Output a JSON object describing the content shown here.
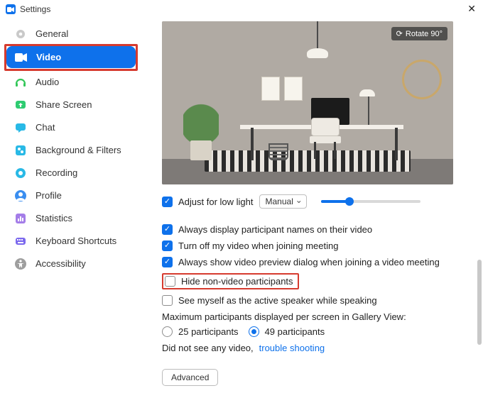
{
  "window": {
    "title": "Settings"
  },
  "sidebar": {
    "items": [
      {
        "id": "general",
        "label": "General",
        "icon": "gear-icon"
      },
      {
        "id": "video",
        "label": "Video",
        "icon": "video-icon",
        "active": true
      },
      {
        "id": "audio",
        "label": "Audio",
        "icon": "headphones-icon"
      },
      {
        "id": "share",
        "label": "Share Screen",
        "icon": "share-screen-icon"
      },
      {
        "id": "chat",
        "label": "Chat",
        "icon": "chat-icon"
      },
      {
        "id": "bgfilters",
        "label": "Background & Filters",
        "icon": "filters-icon"
      },
      {
        "id": "recording",
        "label": "Recording",
        "icon": "record-icon"
      },
      {
        "id": "profile",
        "label": "Profile",
        "icon": "profile-icon"
      },
      {
        "id": "statistics",
        "label": "Statistics",
        "icon": "statistics-icon"
      },
      {
        "id": "shortcuts",
        "label": "Keyboard Shortcuts",
        "icon": "keyboard-icon"
      },
      {
        "id": "accessibility",
        "label": "Accessibility",
        "icon": "accessibility-icon"
      }
    ]
  },
  "preview": {
    "rotate_label": "Rotate 90°"
  },
  "low_light": {
    "checkbox_label": "Adjust for low light",
    "checked": true,
    "mode_label": "Manual"
  },
  "options": [
    {
      "label": "Always display participant names on their video",
      "checked": true
    },
    {
      "label": "Turn off my video when joining meeting",
      "checked": true
    },
    {
      "label": "Always show video preview dialog when joining a video meeting",
      "checked": true
    },
    {
      "label": "Hide non-video participants",
      "checked": false,
      "highlight": true
    },
    {
      "label": "See myself as the active speaker while speaking",
      "checked": false
    }
  ],
  "gallery": {
    "title": "Maximum participants displayed per screen in Gallery View:",
    "opt1": "25 participants",
    "opt2": "49 participants",
    "selected": "opt2"
  },
  "troubleshoot": {
    "prefix": "Did not see any video,",
    "link": "trouble shooting"
  },
  "advanced_label": "Advanced"
}
